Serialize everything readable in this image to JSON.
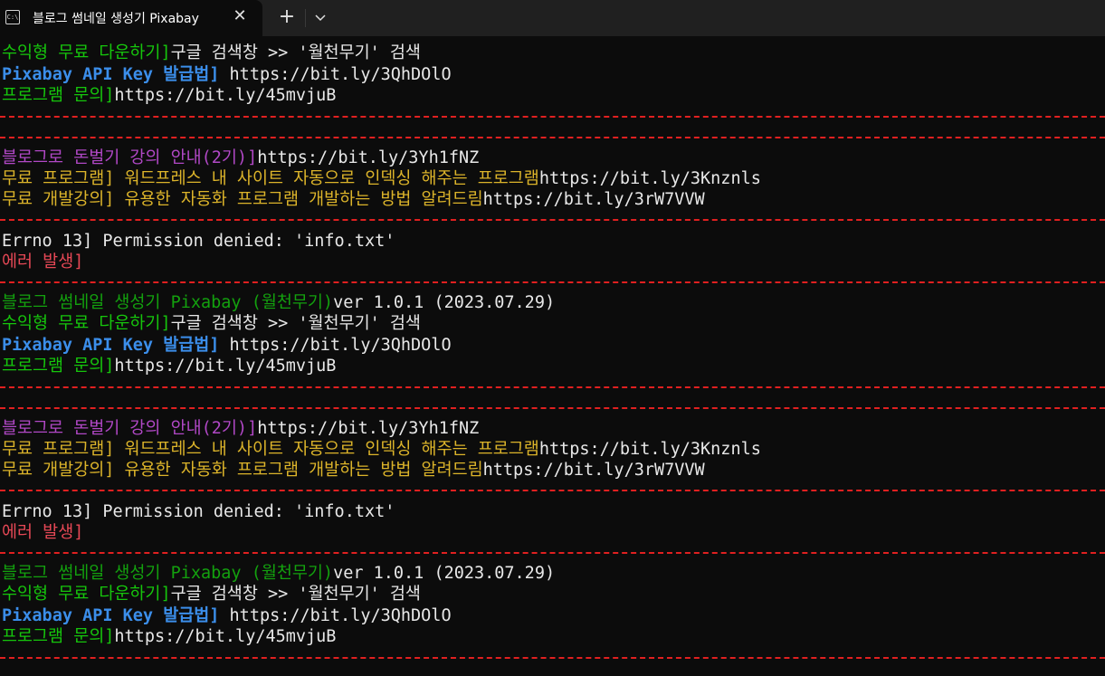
{
  "window": {
    "tab_title": "블로그 썸네일 생성기 Pixabay",
    "tab_icon": "terminal-icon",
    "close_icon": "close-icon",
    "new_tab_icon": "plus-icon",
    "dropdown_icon": "chevron-down-icon"
  },
  "colors": {
    "background": "#0c0c0c",
    "green": "#16c60c",
    "blue": "#3b8eea",
    "purple": "#b148c6",
    "yellow": "#dcb42a",
    "red": "#e74856",
    "white": "#e8e8e8",
    "divider": "#e02020"
  },
  "terminal": {
    "lines": [
      {
        "a": "수익형 무료 다운하기]",
        "b": "구글 검색창 >> '월천무기' 검색"
      },
      {
        "a": "Pixabay API Key 발급법]",
        "b": " https://bit.ly/3QhDOlO"
      },
      {
        "a": "프로그램 문의]",
        "b": "https://bit.ly/45mvjuB"
      },
      {
        "a": "블로그로 돈벌기 강의 안내(2기)]",
        "b": "https://bit.ly/3Yh1fNZ"
      },
      {
        "a": "무료 프로그램] 워드프레스 내 사이트 자동으로 인덱싱 해주는 프로그램",
        "b": "https://bit.ly/3Knznls"
      },
      {
        "a": "무료 개발강의] 유용한 자동화 프로그램 개발하는 방법 알려드림",
        "b": "https://bit.ly/3rW7VVW"
      },
      {
        "a": "",
        "b": "Errno 13] Permission denied: 'info.txt'"
      },
      {
        "a": "에러 발생]",
        "b": ""
      },
      {
        "a": "블로그 썸네일 생성기 Pixabay (월천무기)",
        "b": "ver 1.0.1 (2023.07.29)"
      },
      {
        "a": "수익형 무료 다운하기]",
        "b": "구글 검색창 >> '월천무기' 검색"
      },
      {
        "a": "Pixabay API Key 발급법]",
        "b": " https://bit.ly/3QhDOlO"
      },
      {
        "a": "프로그램 문의]",
        "b": "https://bit.ly/45mvjuB"
      },
      {
        "a": "블로그로 돈벌기 강의 안내(2기)]",
        "b": "https://bit.ly/3Yh1fNZ"
      },
      {
        "a": "무료 프로그램] 워드프레스 내 사이트 자동으로 인덱싱 해주는 프로그램",
        "b": "https://bit.ly/3Knznls"
      },
      {
        "a": "무료 개발강의] 유용한 자동화 프로그램 개발하는 방법 알려드림",
        "b": "https://bit.ly/3rW7VVW"
      },
      {
        "a": "",
        "b": "Errno 13] Permission denied: 'info.txt'"
      },
      {
        "a": "에러 발생]",
        "b": ""
      },
      {
        "a": "블로그 썸네일 생성기 Pixabay (월천무기)",
        "b": "ver 1.0.1 (2023.07.29)"
      },
      {
        "a": "수익형 무료 다운하기]",
        "b": "구글 검색창 >> '월천무기' 검색"
      },
      {
        "a": "Pixabay API Key 발급법]",
        "b": " https://bit.ly/3QhDOlO"
      },
      {
        "a": "프로그램 문의]",
        "b": "https://bit.ly/45mvjuB"
      }
    ]
  }
}
